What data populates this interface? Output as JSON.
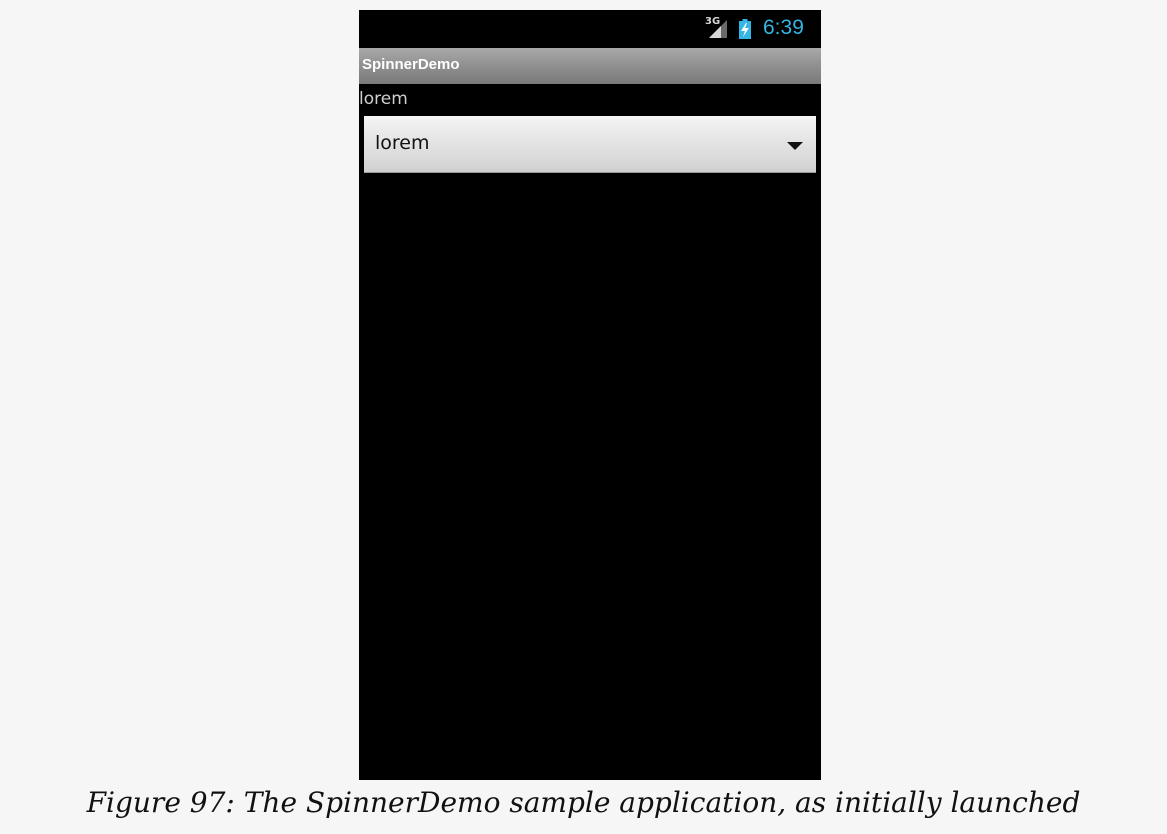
{
  "status_bar": {
    "network_type": "3G",
    "signal_icon": "cellular-signal-icon",
    "battery_icon": "battery-charging-icon",
    "time": "6:39",
    "time_color": "#33b5e5"
  },
  "app": {
    "title": "SpinnerDemo"
  },
  "main": {
    "selection_label": "lorem",
    "spinner": {
      "selected_value": "lorem",
      "arrow_icon": "dropdown-arrow-icon"
    }
  },
  "caption": "Figure 97: The SpinnerDemo sample application, as initially launched"
}
